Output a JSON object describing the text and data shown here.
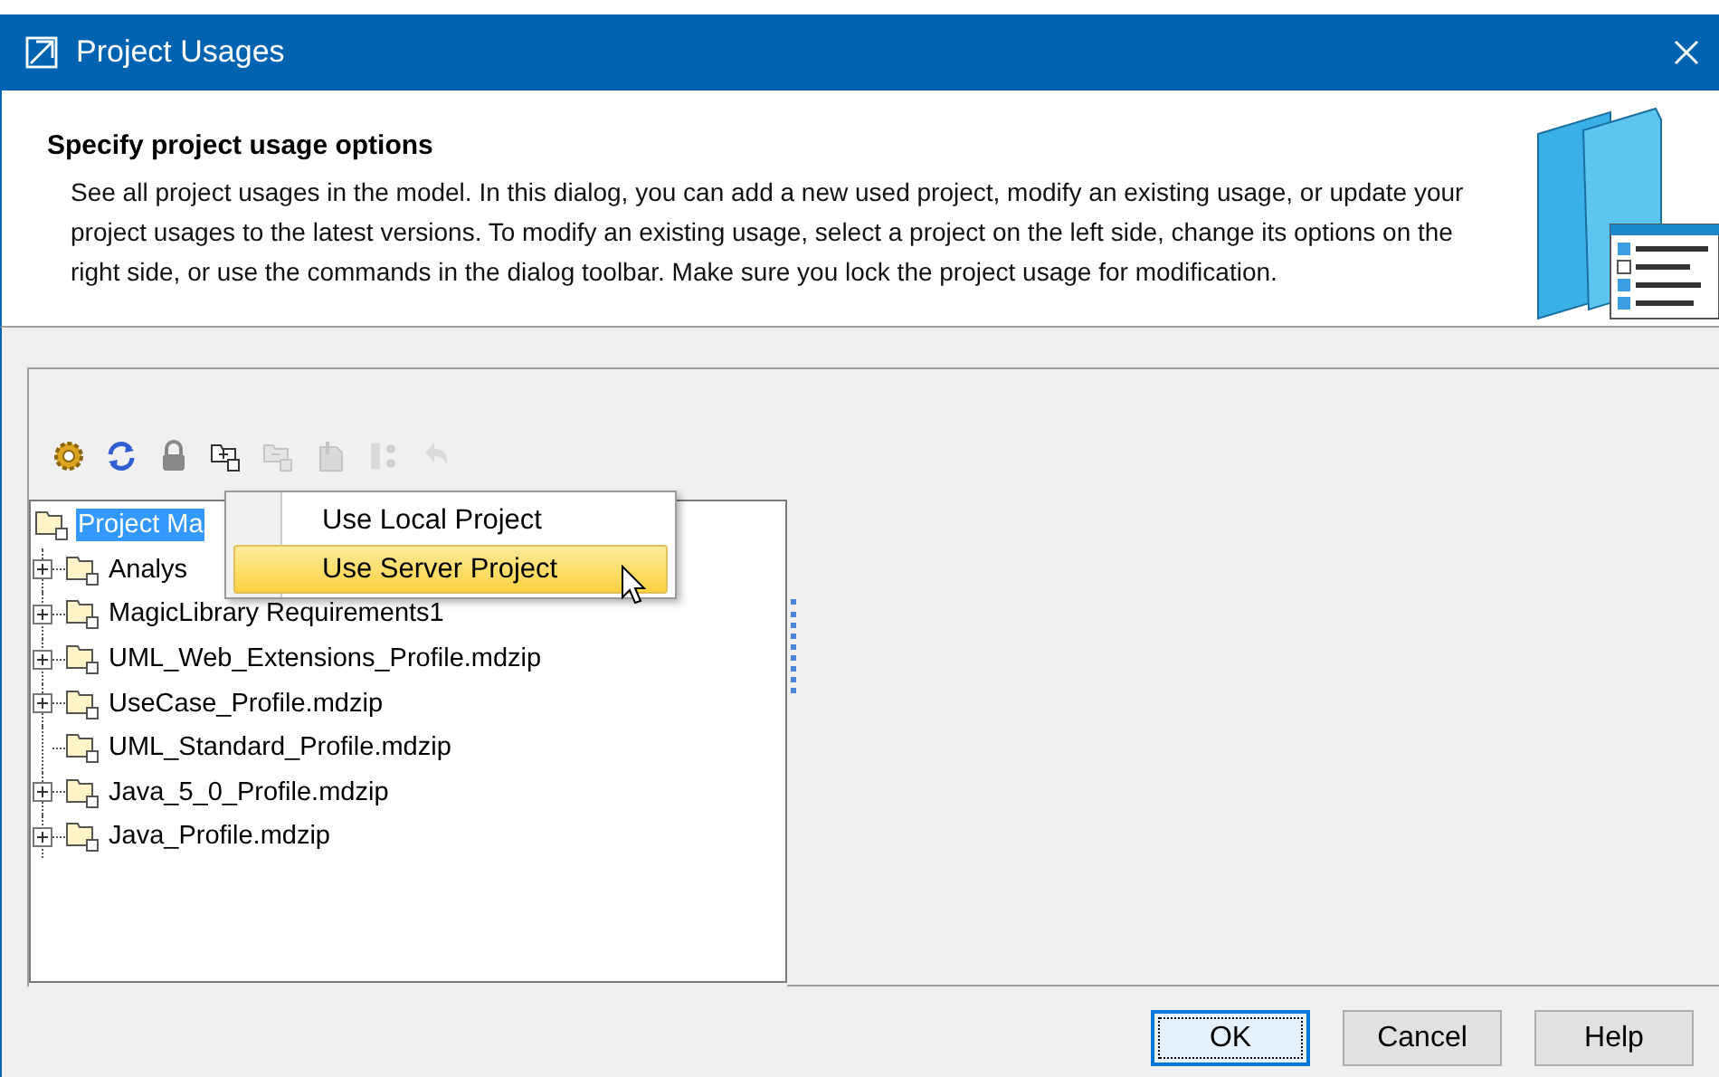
{
  "window": {
    "title": "Project Usages"
  },
  "header": {
    "heading": "Specify project usage options",
    "description": "See all project usages in the model. In this dialog, you can add a new used project, modify an existing usage, or update your project usages to the latest versions. To modify an existing usage, select a project on the left side, change its options on the right side, or use the commands in the dialog toolbar. Make sure you lock the project usage for modification."
  },
  "toolbar": [
    {
      "kind": "settings",
      "disabled": false
    },
    {
      "kind": "refresh",
      "disabled": false
    },
    {
      "kind": "lock",
      "disabled": false
    },
    {
      "kind": "add",
      "disabled": false
    },
    {
      "kind": "remove",
      "disabled": true
    },
    {
      "kind": "attach",
      "disabled": true
    },
    {
      "kind": "tree",
      "disabled": true
    },
    {
      "kind": "undo",
      "disabled": true
    }
  ],
  "tree": {
    "label": "Project Ma",
    "selected": true,
    "children": [
      {
        "label": "Analys",
        "kind": "collapsed",
        "selected": false
      },
      {
        "label": "MagicLibrary Requirements1",
        "kind": "collapsed",
        "selected": false
      },
      {
        "label": "UML_Web_Extensions_Profile.mdzip",
        "kind": "collapsed",
        "selected": false
      },
      {
        "label": "UseCase_Profile.mdzip",
        "kind": "collapsed",
        "selected": false
      },
      {
        "label": "UML_Standard_Profile.mdzip",
        "kind": "leaf",
        "selected": false
      },
      {
        "label": "Java_5_0_Profile.mdzip",
        "kind": "collapsed",
        "selected": false
      },
      {
        "label": "Java_Profile.mdzip",
        "kind": "collapsed",
        "selected": false
      }
    ]
  },
  "menu": [
    {
      "label": "Use Local Project",
      "selected": false
    },
    {
      "label": "Use Server Project",
      "selected": true
    }
  ],
  "buttons": [
    {
      "label": "OK",
      "default": true
    },
    {
      "label": "Cancel",
      "default": false
    },
    {
      "label": "Help",
      "default": false
    }
  ]
}
